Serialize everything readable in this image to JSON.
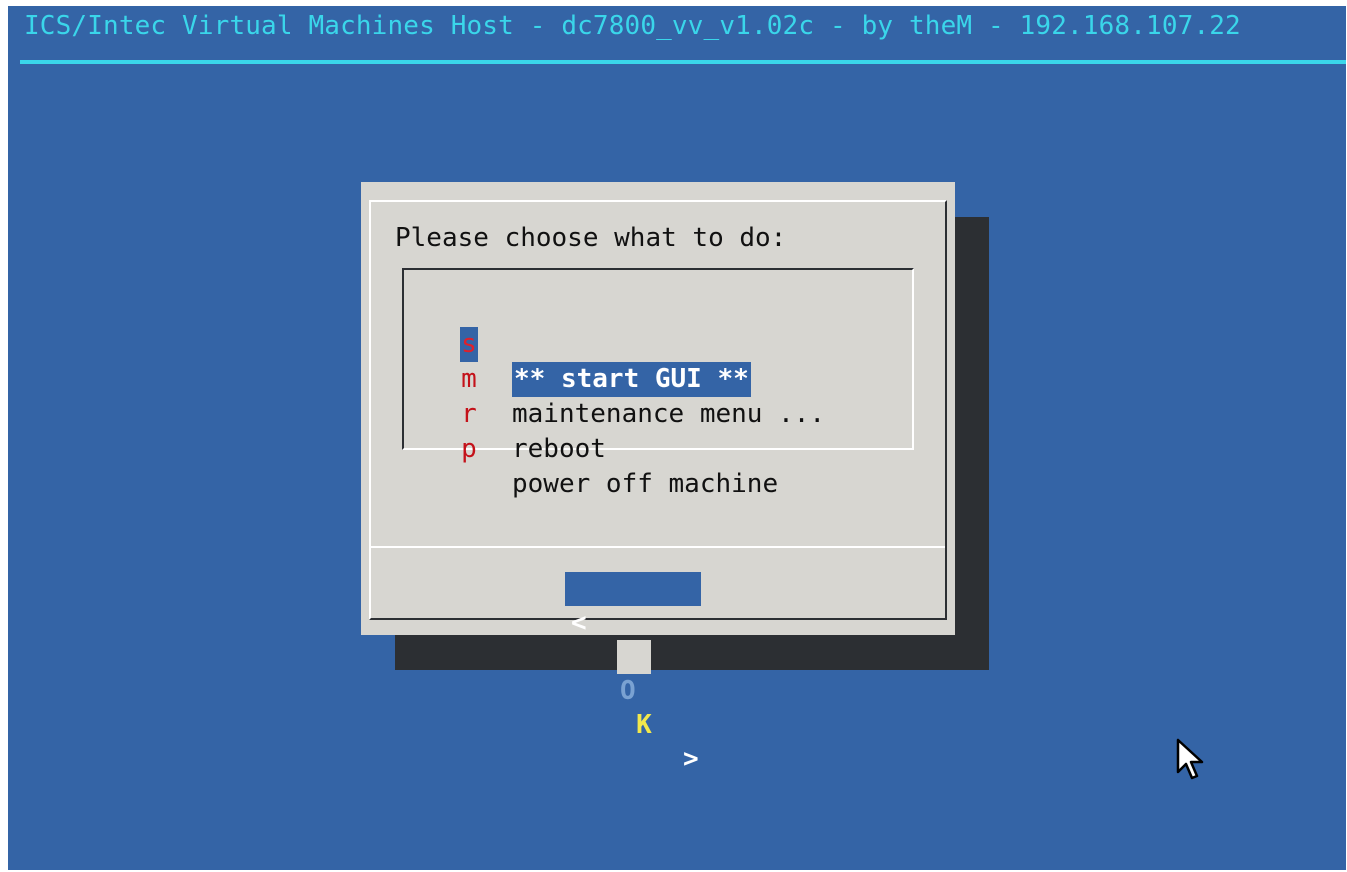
{
  "backtitle": "ICS/Intec Virtual Machines Host - dc7800_vv_v1.02c - by theM - 192.168.107.22",
  "dialog": {
    "prompt": "Please choose what to do:",
    "menu": [
      {
        "key": "s",
        "label": "** start GUI **",
        "selected": true
      },
      {
        "key": "m",
        "label": "maintenance menu ...",
        "selected": false
      },
      {
        "key": "r",
        "label": "reboot",
        "selected": false
      },
      {
        "key": "p",
        "label": "power off machine",
        "selected": false
      }
    ],
    "ok_button": {
      "open": "<",
      "first": "O",
      "hotkey": "K",
      "close": ">"
    }
  },
  "colors": {
    "background": "#3464a6",
    "title": "#3ad6ea",
    "dialog": "#d7d6d1",
    "shadow": "#2c2f33",
    "hotkey": "#c4121a",
    "button_hotkey": "#f2e84c"
  },
  "icons": {
    "cursor": "mouse-pointer-icon"
  }
}
